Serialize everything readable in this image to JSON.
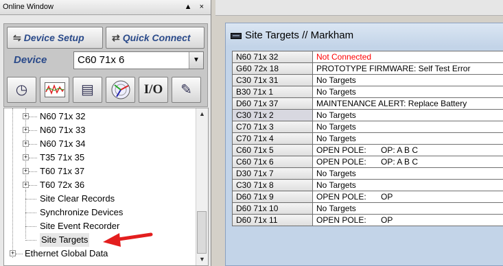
{
  "online_window": {
    "title": "Online Window",
    "title_controls": "▲ ×",
    "device_setup_label": "Device Setup",
    "quick_connect_label": "Quick Connect",
    "device_label": "Device",
    "device_value": "C60 71x 6",
    "icon_buttons": [
      "clock-calendar-icon",
      "waveform-icon",
      "documents-icon",
      "phasor-icon",
      "io-icon",
      "settings-file-icon"
    ],
    "io_label": "I/O"
  },
  "tree": {
    "devices": [
      "N60 71x 32",
      "N60 71x 33",
      "N60 71x 34",
      "T35 71x 35",
      "T60 71x 37",
      "T60 72x 36"
    ],
    "site_items": [
      "Site Clear Records",
      "Synchronize Devices",
      "Site Event Recorder",
      "Site Targets"
    ],
    "root_items": [
      "Ethernet Global Data"
    ]
  },
  "site_targets": {
    "title": "Site Targets // Markham",
    "rows": [
      {
        "device": "N60 71x 32",
        "status": "Not Connected",
        "status_color": "#ff0000"
      },
      {
        "device": "G60 72x 18",
        "status": "PROTOTYPE FIRMWARE: Self Test Error"
      },
      {
        "device": "C30 71x 31",
        "status": "No Targets"
      },
      {
        "device": "B30 71x 1",
        "status": "No Targets"
      },
      {
        "device": "D60 71x 37",
        "status": "MAINTENANCE ALERT:  Replace Battery"
      },
      {
        "device": "C30 71x 2",
        "status": "No Targets"
      },
      {
        "device": "C70 71x 3",
        "status": "No Targets"
      },
      {
        "device": "C70 71x 4",
        "status": "No Targets"
      },
      {
        "device": "C60 71x 5",
        "status": "OPEN POLE:",
        "detail": "OP: A B C"
      },
      {
        "device": "C60 71x 6",
        "status": "OPEN POLE:",
        "detail": "OP: A B C"
      },
      {
        "device": "D30 71x 7",
        "status": "No Targets"
      },
      {
        "device": "C30 71x 8",
        "status": "No Targets"
      },
      {
        "device": "D60 71x 9",
        "status": "OPEN POLE:",
        "detail": "OP"
      },
      {
        "device": "D60 71x 10",
        "status": "No Targets"
      },
      {
        "device": "D60 71x 11",
        "status": "OPEN POLE:",
        "detail": "OP"
      }
    ]
  },
  "colors": {
    "accent_text": "#2a4a8a",
    "alert_red": "#ff0000",
    "window_blue": "#c3d4e8",
    "arrow_red": "#e31e1e"
  }
}
